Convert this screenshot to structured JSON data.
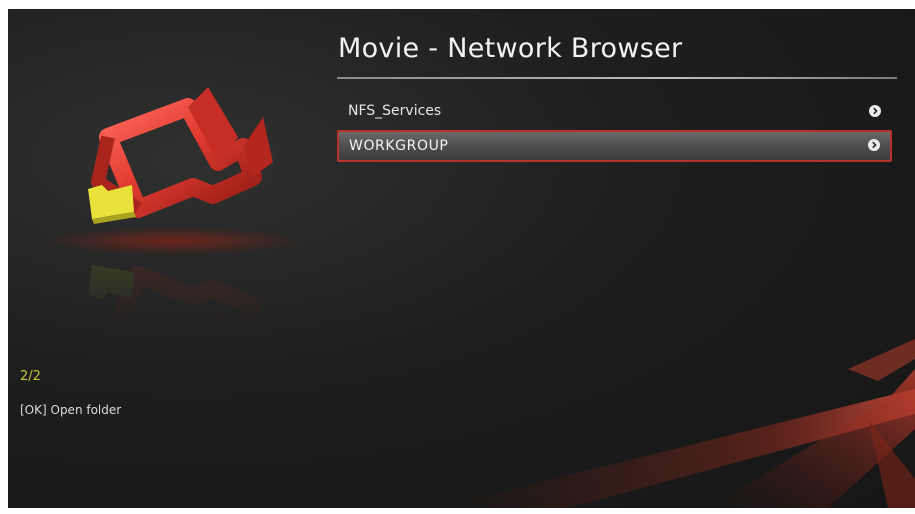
{
  "header": {
    "title": "Movie  - Network Browser"
  },
  "browser_list": {
    "items": [
      {
        "label": "NFS_Services",
        "selected": false
      },
      {
        "label": "WORKGROUP",
        "selected": true
      }
    ]
  },
  "status": {
    "position": "2/2",
    "hint": "[OK] Open folder"
  },
  "icons": {
    "app_icon": "movie-camera-folder-icon",
    "item_arrow": "chevron-right-circle-icon"
  },
  "colors": {
    "accent": "#b8322c",
    "counter": "#c4c63a",
    "background": "#1d1e1d"
  }
}
